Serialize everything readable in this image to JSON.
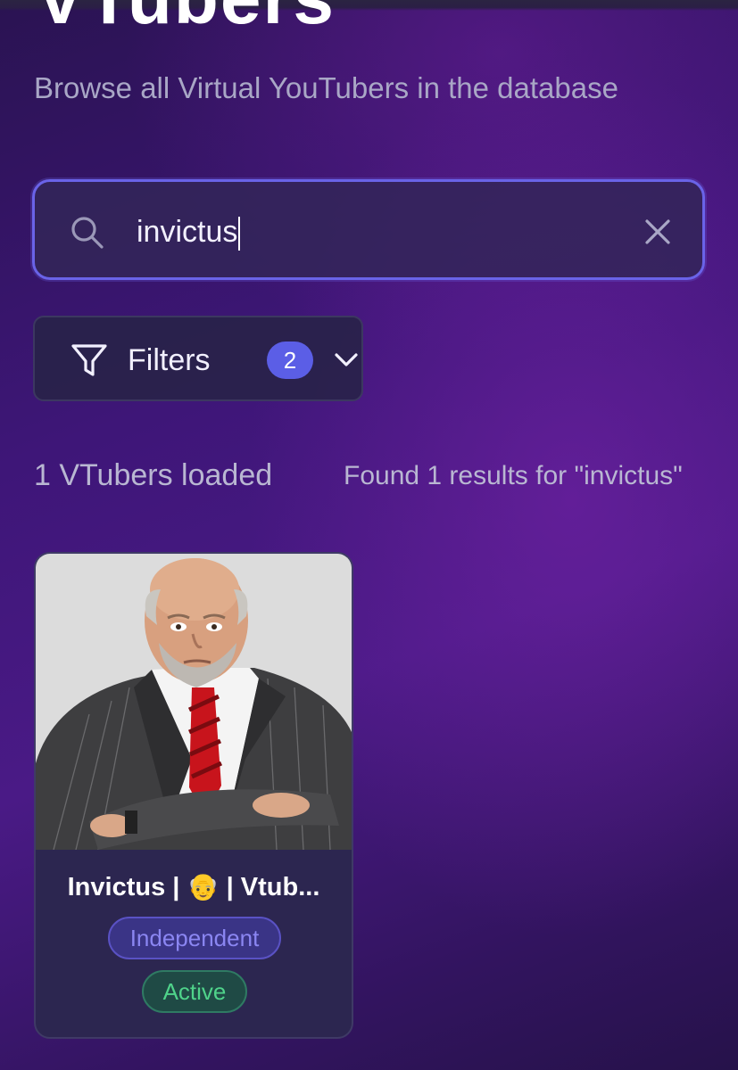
{
  "header": {
    "title": "VTubers",
    "subtitle": "Browse all Virtual YouTubers in the database"
  },
  "search": {
    "value": "invictus",
    "icon": "search-icon",
    "clear_icon": "close-icon"
  },
  "filters": {
    "label": "Filters",
    "count": "2",
    "icon": "filter-icon",
    "toggle_icon": "chevron-down-icon"
  },
  "results": {
    "loaded_text": "1 VTubers loaded",
    "found_text": "Found 1 results for \"invictus\""
  },
  "cards": [
    {
      "name": "Invictus | 👴 | Vtub...",
      "affiliation": "Independent",
      "status": "Active"
    }
  ],
  "colors": {
    "accent": "#6a63e8",
    "badge": "#5b5ee6",
    "independent_tag": "#8b86f2",
    "active_tag": "#4fd38a"
  }
}
